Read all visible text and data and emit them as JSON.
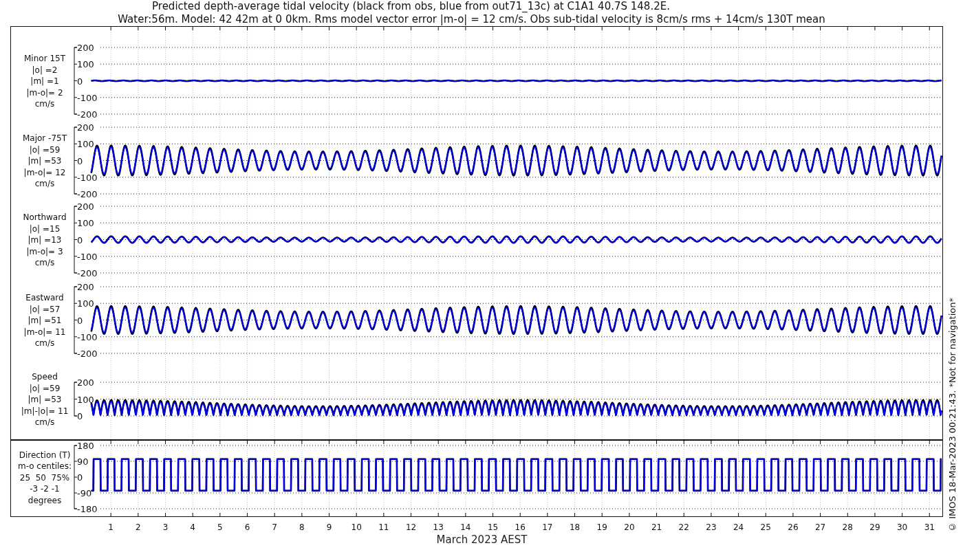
{
  "title_lines": [
    "Predicted depth-average tidal velocity (black from obs, blue from out71_13c) at C1A1 40.7S 148.2E.",
    "Water:56m. Model: 42 42m at 0 0km. Rms model vector error |m-o| = 12 cm/s. Obs sub-tidal velocity is 8cm/s rms + 14cm/s 130T mean"
  ],
  "panels": [
    {
      "kind": "minor",
      "label_lines": [
        "Minor 15T",
        "|o| =2",
        "|m| =1",
        "|m-o|= 2",
        "cm/s"
      ],
      "yticks": [
        "200",
        "100",
        "0",
        "-100",
        "-200"
      ]
    },
    {
      "kind": "major",
      "label_lines": [
        "Major -75T",
        "|o| =59",
        "|m| =53",
        "|m-o|= 12",
        "cm/s"
      ],
      "yticks": [
        "200",
        "100",
        "0",
        "-100",
        "-200"
      ]
    },
    {
      "kind": "northward",
      "label_lines": [
        "Northward",
        "|o| =15",
        "|m| =13",
        "|m-o|= 3",
        "cm/s"
      ],
      "yticks": [
        "200",
        "100",
        "0",
        "-100",
        "-200"
      ]
    },
    {
      "kind": "eastward",
      "label_lines": [
        "Eastward",
        "|o| =57",
        "|m| =51",
        "|m-o|= 11",
        "cm/s"
      ],
      "yticks": [
        "200",
        "100",
        "0",
        "-100",
        "-200"
      ]
    },
    {
      "kind": "speed",
      "label_lines": [
        "Speed",
        "|o| =59",
        "|m| =53",
        "|m|-|o|= 11",
        "cm/s"
      ],
      "yticks": [
        "200",
        "100",
        "0"
      ]
    },
    {
      "kind": "direction",
      "label_lines": [
        "Direction (T)",
        "m-o centiles:",
        "25  50  75%",
        "-3 -2 -1",
        "degrees"
      ],
      "yticks": [
        "180",
        "90",
        "0",
        "-90",
        "-180"
      ]
    }
  ],
  "xticks": [
    "1",
    "2",
    "3",
    "4",
    "5",
    "6",
    "7",
    "8",
    "9",
    "10",
    "11",
    "12",
    "13",
    "14",
    "15",
    "16",
    "17",
    "18",
    "19",
    "20",
    "21",
    "22",
    "23",
    "24",
    "25",
    "26",
    "27",
    "28",
    "29",
    "30",
    "31"
  ],
  "xlabel": "March 2023 AEST",
  "footer_note": "© IMOS 18-Mar-2023 00:21:43. *Not for navigation*"
}
